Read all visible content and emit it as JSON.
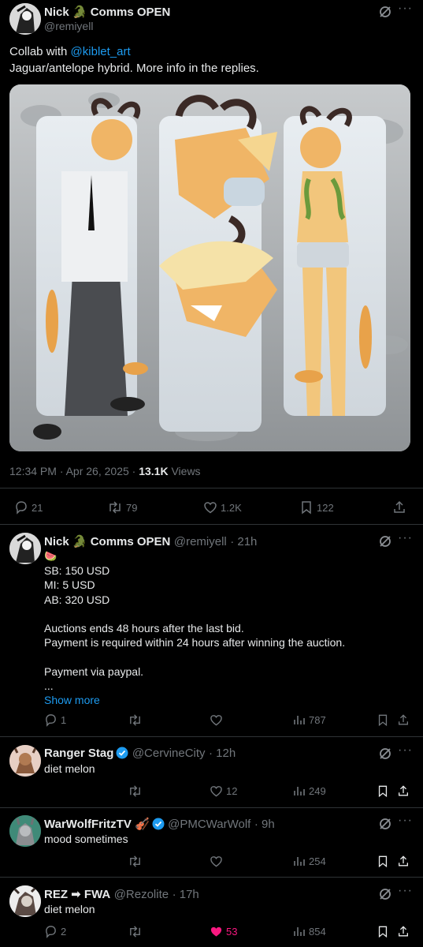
{
  "main_post": {
    "display_name": "Nick 🐊 Comms OPEN",
    "handle": "@remiyell",
    "text_line1_prefix": "Collab with ",
    "mention": "@kiblet_art",
    "text_line2": "Jaguar/antelope hybrid. More info in the replies.",
    "timestamp": "12:34 PM · Apr 26, 2025 · ",
    "views_count": "13.1K",
    "views_label": " Views",
    "replies": "21",
    "reposts": "79",
    "likes": "1.2K",
    "bookmarks": "122"
  },
  "reply1": {
    "display_name": "Nick 🐊 Comms OPEN",
    "handle": "@remiyell",
    "time": "· 21h",
    "emoji": "🍉",
    "lines": [
      "SB: 150 USD",
      "MI: 5 USD",
      "AB: 320 USD",
      "",
      "Auctions ends 48 hours after the last bid.",
      "Payment is required within 24 hours after winning the auction.",
      "",
      "Payment via paypal.",
      "..."
    ],
    "show_more": "Show more",
    "replies": "1",
    "views": "787"
  },
  "reply2": {
    "display_name": "Ranger Stag",
    "handle": "@CervineCity",
    "time": "· 12h",
    "text": "diet melon",
    "likes": "12",
    "views": "249"
  },
  "reply3": {
    "display_name": "WarWolfFritzTV 🎻",
    "handle": "@PMCWarWolf",
    "time": "· 9h",
    "text": "mood sometimes",
    "views": "254"
  },
  "reply4": {
    "display_name": "REZ ➡ FWA",
    "handle": "@Rezolite",
    "time": "· 17h",
    "text": "diet melon",
    "replies": "2",
    "likes": "53",
    "views": "854"
  },
  "colors": {
    "accent": "#1d9bf0",
    "like_active": "#f91880",
    "muted": "#71767b",
    "divider": "#2f3336"
  }
}
